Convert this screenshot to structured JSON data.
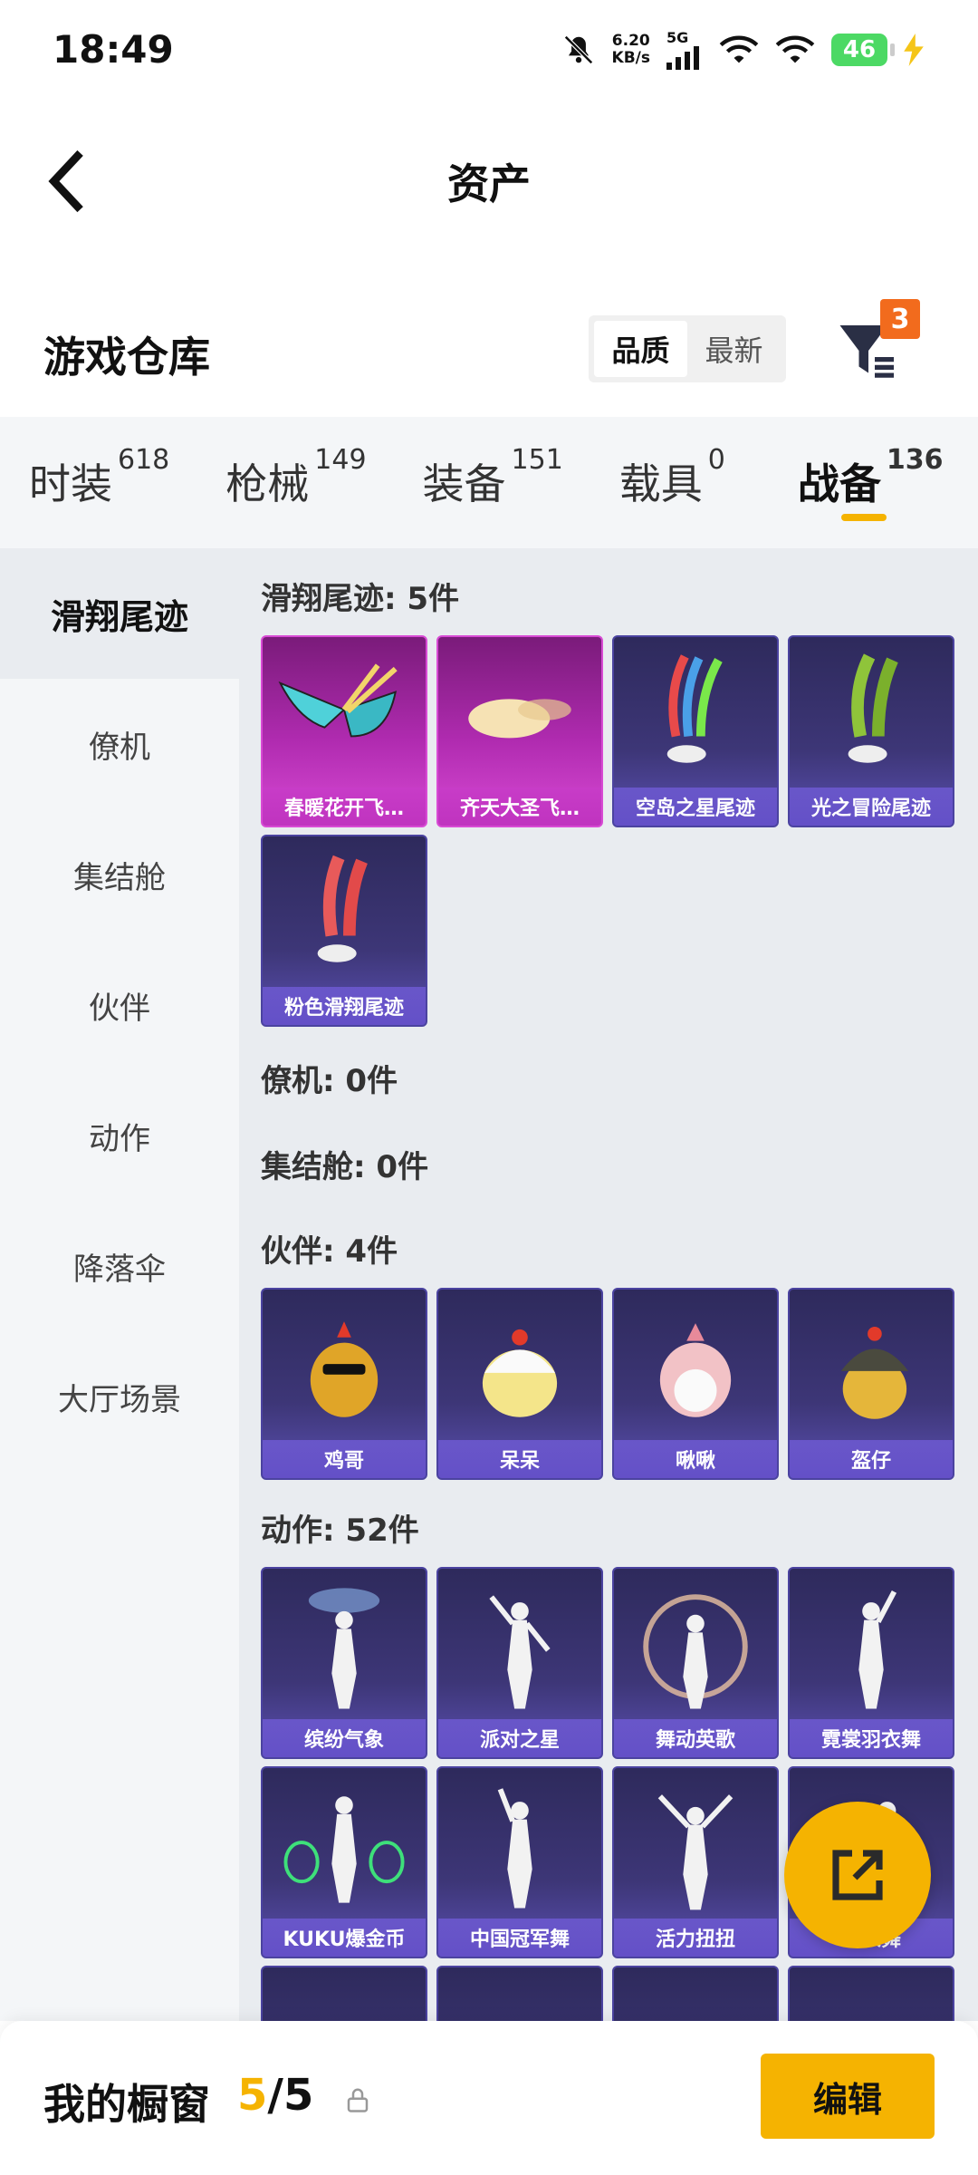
{
  "status": {
    "time": "18:49",
    "net_speed_value": "6.20",
    "net_speed_unit": "KB/s",
    "signal_label": "5G",
    "battery": "46"
  },
  "header": {
    "title": "资产"
  },
  "section": {
    "title": "游戏仓库",
    "sort_options": [
      "品质",
      "最新"
    ],
    "filter_badge": "3"
  },
  "tabs": [
    {
      "label": "时装",
      "count": "618"
    },
    {
      "label": "枪械",
      "count": "149"
    },
    {
      "label": "装备",
      "count": "151"
    },
    {
      "label": "载具",
      "count": "0"
    },
    {
      "label": "战备",
      "count": "136"
    }
  ],
  "sidebar": [
    "滑翔尾迹",
    "僚机",
    "集结舱",
    "伙伴",
    "动作",
    "降落伞",
    "大厅场景"
  ],
  "groups": {
    "glide": {
      "title": "滑翔尾迹: 5件",
      "items": [
        "春暖花开飞…",
        "齐天大圣飞…",
        "空岛之星尾迹",
        "光之冒险尾迹",
        "粉色滑翔尾迹"
      ]
    },
    "wingman": {
      "title": "僚机: 0件"
    },
    "pod": {
      "title": "集结舱: 0件"
    },
    "partner": {
      "title": "伙伴: 4件",
      "items": [
        "鸡哥",
        "呆呆",
        "啾啾",
        "盔仔"
      ]
    },
    "emote": {
      "title": "动作: 52件",
      "items": [
        "缤纷气象",
        "派对之星",
        "舞动英歌",
        "霓裳羽衣舞",
        "KUKU爆金币",
        "中国冠军舞",
        "活力扭扭",
        "…衣舞"
      ]
    }
  },
  "bottom": {
    "label": "我的橱窗",
    "current": "5",
    "separator": "/",
    "total": "5",
    "edit_label": "编辑"
  },
  "colors": {
    "accent": "#f5b301",
    "badge": "#f26b1d",
    "card_purple": "#3d3677",
    "card_pink": "#b02bb0"
  }
}
